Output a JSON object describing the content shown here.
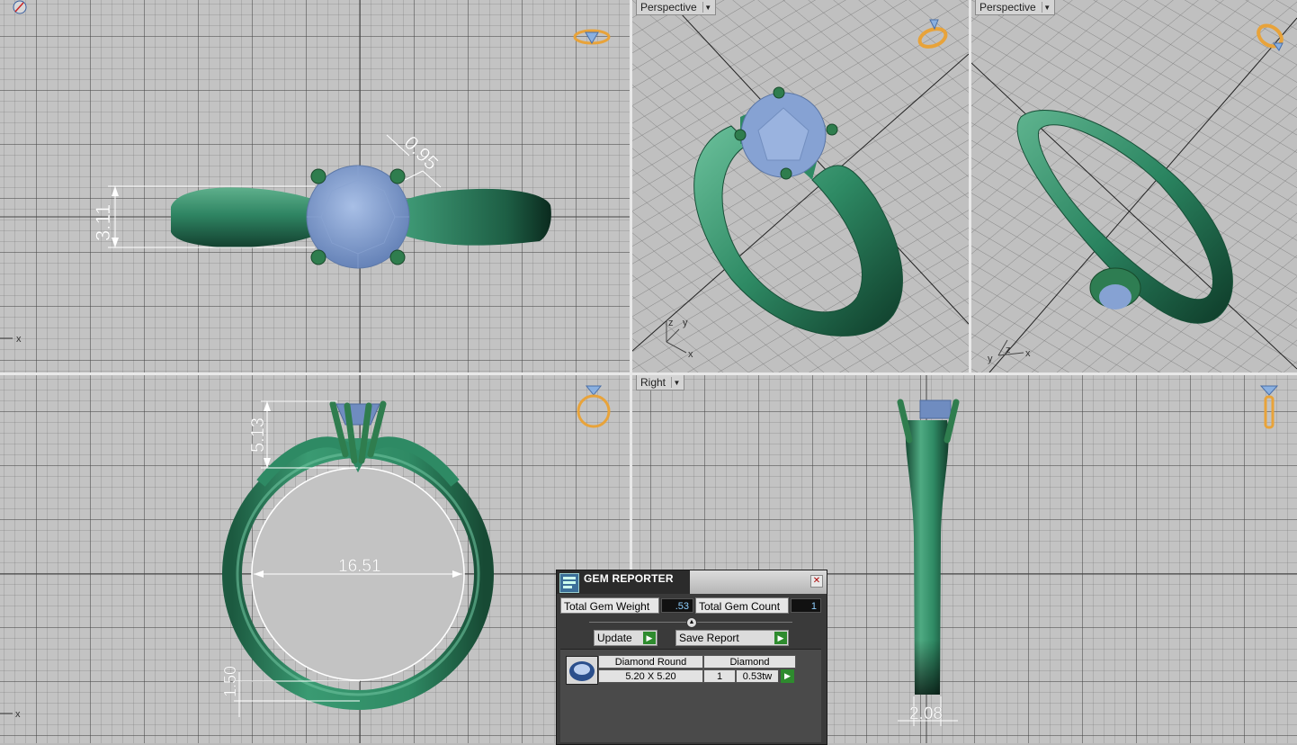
{
  "viewports": {
    "top_left": {
      "axis_label": "x",
      "dimensions": [
        "3.11",
        "0.95"
      ]
    },
    "top_middle": {
      "label": "Perspective",
      "axes": [
        "z",
        "y",
        "x"
      ]
    },
    "top_right": {
      "label": "Perspective",
      "axes": [
        "y",
        "z",
        "x"
      ]
    },
    "bottom_left": {
      "axis_label": "x",
      "dimensions": [
        "5.13",
        "16.51",
        "1.50"
      ]
    },
    "bottom_right": {
      "label": "Right",
      "dimensions": [
        "2.08"
      ]
    }
  },
  "gem_reporter": {
    "title": "GEM REPORTER",
    "close_icon": "close-icon",
    "total_weight_label": "Total Gem Weight",
    "total_weight_value": ".53",
    "total_count_label": "Total Gem Count",
    "total_count_value": "1",
    "update_label": "Update",
    "save_label": "Save Report",
    "gems": [
      {
        "name": "Diamond Round",
        "material": "Diamond",
        "size": "5.20 X 5.20",
        "count": "1",
        "weight": "0.53tw"
      }
    ]
  },
  "colors": {
    "metal": "#2f7d5e",
    "gem": "#7f9ccc",
    "accent_cube": "#e8a33a"
  }
}
